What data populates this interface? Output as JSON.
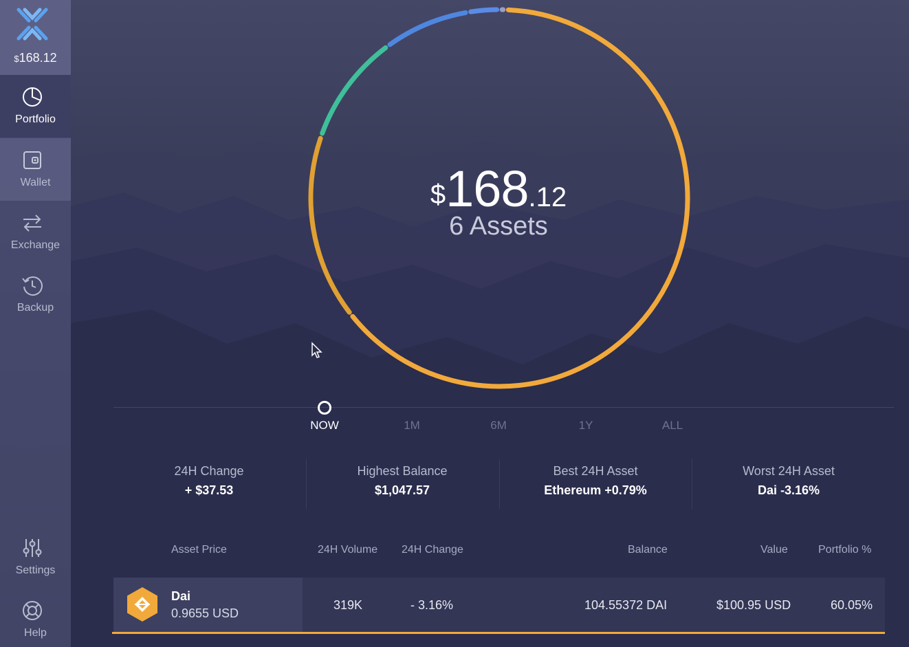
{
  "app": {
    "balance_cents_prefix": "$",
    "balance": "168.12"
  },
  "sidebar": {
    "items": [
      {
        "label": "Portfolio",
        "icon": "pie-chart-icon",
        "active": true
      },
      {
        "label": "Wallet",
        "icon": "wallet-icon"
      },
      {
        "label": "Exchange",
        "icon": "exchange-arrows-icon"
      },
      {
        "label": "Backup",
        "icon": "backup-clock-icon"
      },
      {
        "label": "Settings",
        "icon": "sliders-icon"
      },
      {
        "label": "Help",
        "icon": "lifebuoy-icon"
      }
    ]
  },
  "portfolio": {
    "currency_symbol": "$",
    "total_int": "168",
    "total_dec": ".12",
    "assets_label": "6 Assets",
    "ring_segments": [
      {
        "asset": "Dai",
        "portion": 0.6005,
        "color": "#f2a93b"
      },
      {
        "asset": "segment-2",
        "portion": 0.15,
        "color": "#e0a032"
      },
      {
        "asset": "segment-3",
        "portion": 0.09,
        "color": "#3fbf9a"
      },
      {
        "asset": "segment-4",
        "portion": 0.07,
        "color": "#4f86e0"
      },
      {
        "asset": "segment-5",
        "portion": 0.025,
        "color": "#5a8be6"
      },
      {
        "asset": "segment-6",
        "portion": 0.005,
        "color": "#9aa0c0"
      }
    ]
  },
  "timeline": {
    "options": [
      "NOW",
      "1M",
      "6M",
      "1Y",
      "ALL"
    ],
    "selected": "NOW"
  },
  "stats": [
    {
      "label": "24H Change",
      "value": "+ $37.53"
    },
    {
      "label": "Highest Balance",
      "value": "$1,047.57"
    },
    {
      "label": "Best 24H Asset",
      "value": "Ethereum +0.79%"
    },
    {
      "label": "Worst 24H Asset",
      "value": "Dai -3.16%"
    }
  ],
  "table": {
    "headers": {
      "asset_price": "Asset Price",
      "volume": "24H Volume",
      "change": "24H Change",
      "balance": "Balance",
      "value": "Value",
      "portfolio": "Portfolio %"
    },
    "rows": [
      {
        "name": "Dai",
        "price": "0.9655 USD",
        "volume": "319K",
        "change": "- 3.16%",
        "balance": "104.55372 DAI",
        "value": "$100.95 USD",
        "portfolio": "60.05%",
        "icon": "dai-coin-icon",
        "accent": "#f2a93b"
      }
    ]
  }
}
